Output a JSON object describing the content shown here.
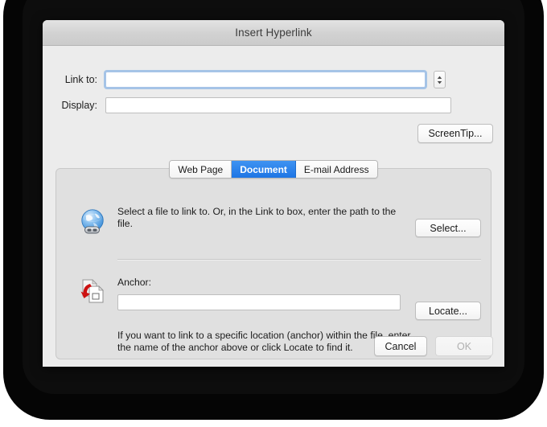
{
  "window": {
    "title": "Insert Hyperlink"
  },
  "form": {
    "link_to": {
      "label": "Link to:",
      "value": "",
      "placeholder": ""
    },
    "display": {
      "label": "Display:",
      "value": "",
      "placeholder": ""
    },
    "stepper_icon": "stepper-up-down-icon",
    "screentip_button": "ScreenTip..."
  },
  "tabs": [
    {
      "label": "Web Page",
      "active": false
    },
    {
      "label": "Document",
      "active": true
    },
    {
      "label": "E-mail Address",
      "active": false
    }
  ],
  "panel": {
    "file_section": {
      "icon": "globe-link-icon",
      "description": "Select a file to link to. Or, in the Link to box, enter the path to the file.",
      "button": "Select..."
    },
    "anchor_section": {
      "icon": "document-anchor-icon",
      "label": "Anchor:",
      "value": "",
      "placeholder": "",
      "button": "Locate...",
      "help": "If you want to link to a specific location (anchor) within the file, enter the name of the anchor above or click Locate to find it."
    }
  },
  "footer": {
    "cancel": "Cancel",
    "ok": "OK",
    "ok_disabled": true
  },
  "colors": {
    "accent": "#1d75e4",
    "dialog_bg": "#ececec",
    "panel_bg": "#e0e0e0",
    "focus_ring": "#6ca4e1",
    "anchor_arrow": "#cc1111"
  }
}
